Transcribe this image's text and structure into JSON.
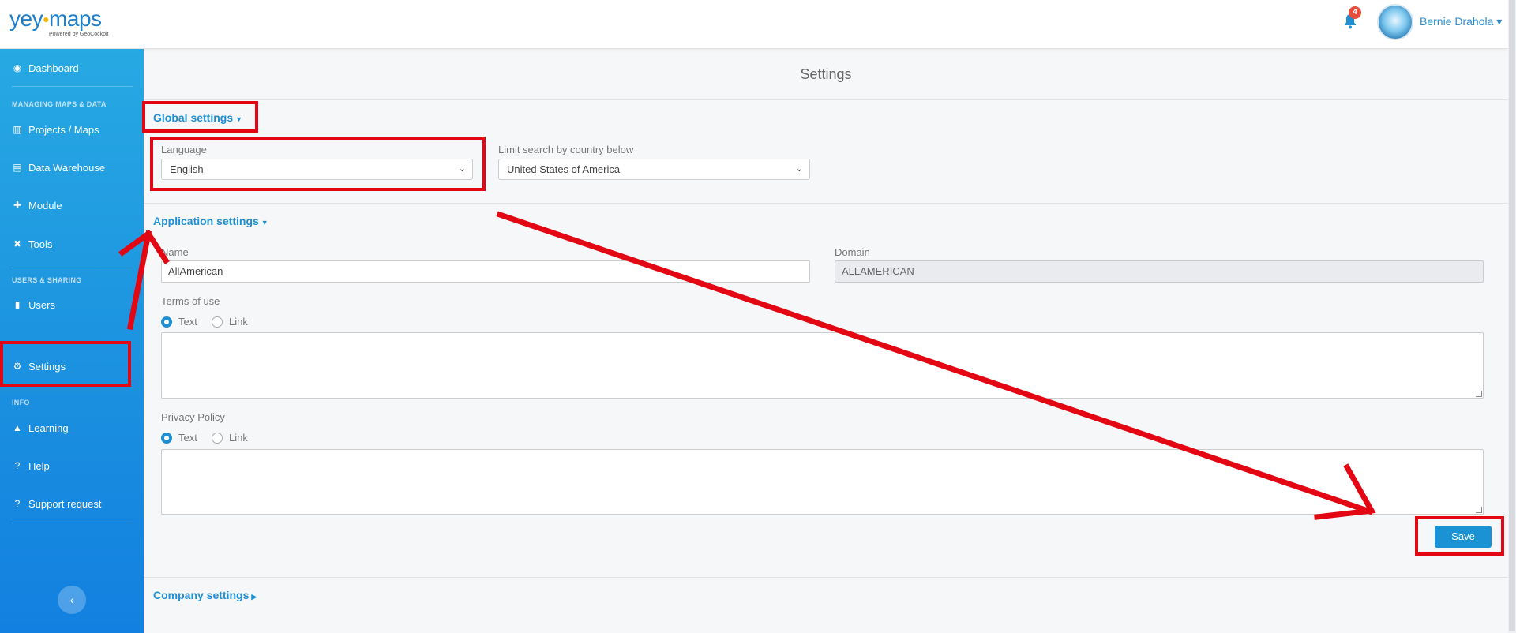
{
  "header": {
    "logo_text": "yey",
    "logo_text_2": "maps",
    "logo_tagline": "Powered by GeoCockpit",
    "notification_count": "4",
    "user_name": "Bernie Drahola ▾"
  },
  "sidebar": {
    "items": [
      {
        "label": "Dashboard",
        "icon": "palette-icon"
      },
      {
        "label": "Projects / Maps",
        "icon": "map-icon"
      },
      {
        "label": "Data Warehouse",
        "icon": "warehouse-icon"
      },
      {
        "label": "Module",
        "icon": "puzzle-icon"
      },
      {
        "label": "Tools",
        "icon": "tools-icon"
      },
      {
        "label": "Users",
        "icon": "clipboard-icon"
      },
      {
        "label": "Settings",
        "icon": "gear-icon"
      },
      {
        "label": "Learning",
        "icon": "graduation-cap-icon"
      },
      {
        "label": "Help",
        "icon": "question-icon"
      },
      {
        "label": "Support request",
        "icon": "question-icon"
      }
    ],
    "sections": {
      "maps": "MANAGING MAPS & DATA",
      "users": "USERS & SHARING",
      "info": "INFO"
    },
    "collapse_glyph": "‹"
  },
  "main": {
    "title": "Settings",
    "global": {
      "title": "Global settings",
      "language_label": "Language",
      "language_value": "English",
      "country_label": "Limit search by country below",
      "country_value": "United States of America"
    },
    "application": {
      "title": "Application settings",
      "name_label": "Name",
      "name_value": "AllAmerican",
      "domain_label": "Domain",
      "domain_value": "ALLAMERICAN",
      "terms_label": "Terms of use",
      "privacy_label": "Privacy Policy",
      "radio_text": "Text",
      "radio_link": "Link",
      "save_label": "Save"
    },
    "company": {
      "title": "Company settings"
    }
  },
  "colors": {
    "accent": "#1f8ed3",
    "sidebar": "#1a8fdf",
    "annotation_red": "#e30613"
  }
}
